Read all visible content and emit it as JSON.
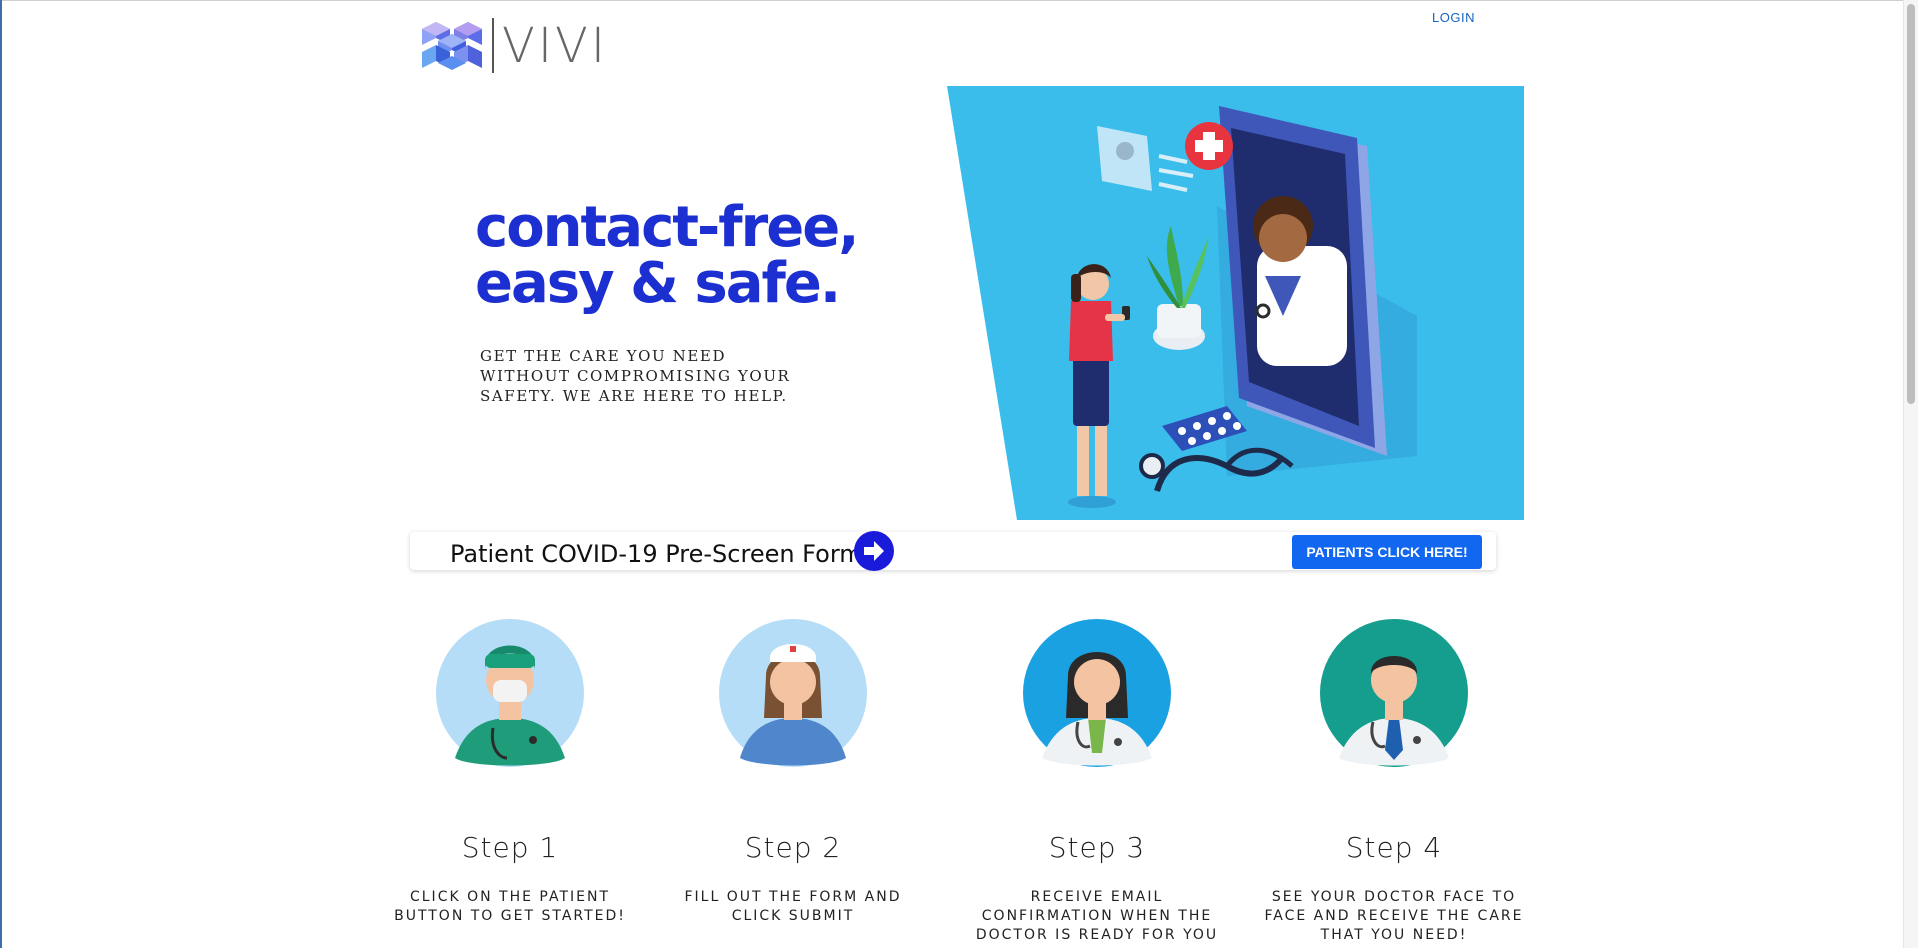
{
  "brand": {
    "name": "VIVI",
    "logo_icon": "cube-logo-icon",
    "accent": "#1c2fd1"
  },
  "nav": {
    "login_label": "LOGIN"
  },
  "hero": {
    "title_line1": "contact-free,",
    "title_line2": "easy & safe.",
    "subtitle": "GET THE CARE YOU NEED WITHOUT COMPROMISING YOUR SAFETY. WE ARE HERE TO HELP.",
    "illustration": "telehealth-doctor-phone-illustration"
  },
  "prescreen": {
    "label": "Patient COVID-19 Pre-Screen Form",
    "arrow_icon": "arrow-right-circle-icon",
    "button_label": "PATIENTS CLICK HERE!",
    "button_color": "#1167ef"
  },
  "steps": [
    {
      "title": "Step 1",
      "desc": "CLICK ON THE PATIENT BUTTON TO GET STARTED!",
      "icon": "surgeon-avatar-icon"
    },
    {
      "title": "Step 2",
      "desc": "FILL OUT THE FORM AND CLICK SUBMIT",
      "icon": "nurse-avatar-icon"
    },
    {
      "title": "Step 3",
      "desc": "RECEIVE EMAIL CONFIRMATION WHEN THE DOCTOR IS READY FOR YOU",
      "icon": "female-doctor-avatar-icon"
    },
    {
      "title": "Step 4",
      "desc": "SEE YOUR DOCTOR FACE TO FACE AND RECEIVE THE CARE THAT YOU NEED!",
      "icon": "male-doctor-avatar-icon"
    }
  ]
}
